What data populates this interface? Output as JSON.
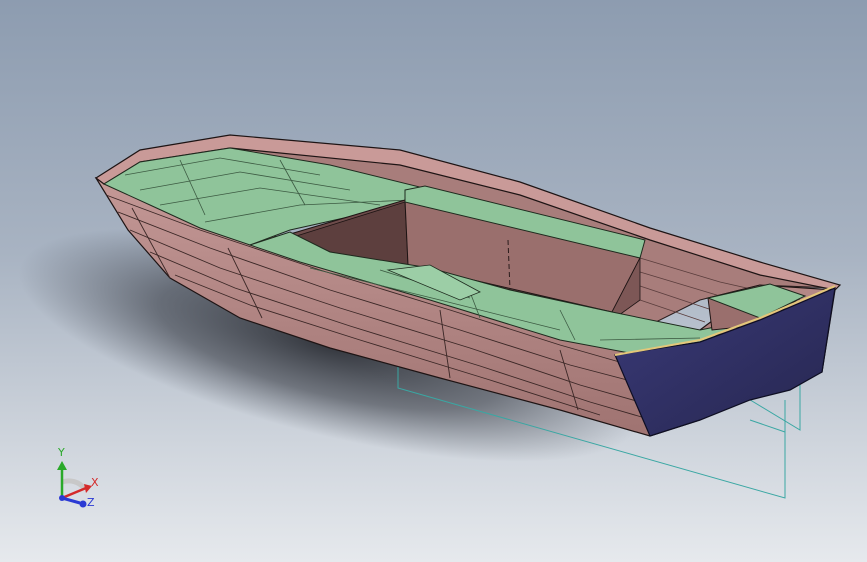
{
  "triad": {
    "y_label": "Y",
    "x_label": "X",
    "z_label": "Z"
  },
  "colors": {
    "background_top": "#8d9cb0",
    "background_bottom": "#e6e9ed",
    "hull": "#b58886",
    "interior": "#98706f",
    "deck": "#8fc49a",
    "transom": "#32326a",
    "sketch_lines": "#3aa7a3",
    "axis_x": "#d42a2a",
    "axis_y": "#2aa92a",
    "axis_z": "#2a3ad4"
  },
  "icons": {
    "view_triad": "xyz-triad-icon"
  }
}
